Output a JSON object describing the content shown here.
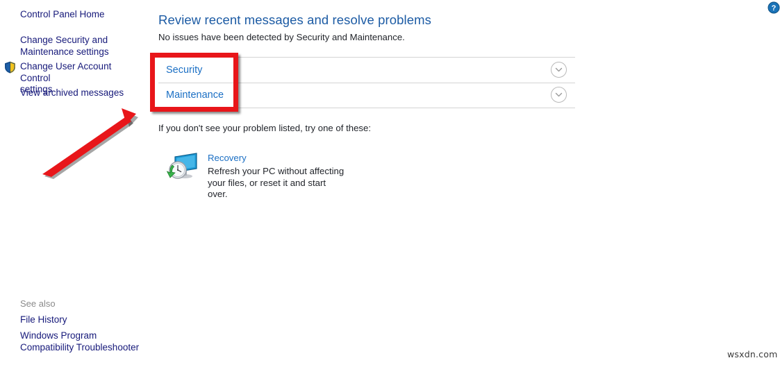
{
  "sidebar": {
    "items": [
      {
        "id": "control-panel-home",
        "label": "Control Panel Home"
      },
      {
        "id": "change-security-maintenance",
        "label": "Change Security and\nMaintenance settings"
      },
      {
        "id": "change-uac",
        "label": "Change User Account Control\nsettings",
        "icon": "uac-shield-icon"
      },
      {
        "id": "view-archived-messages",
        "label": "View archived messages"
      }
    ],
    "see_also": {
      "label": "See also",
      "items": [
        {
          "id": "file-history",
          "label": "File History"
        },
        {
          "id": "windows-program-compatibility-troubleshooter",
          "label": "Windows Program\nCompatibility Troubleshooter"
        }
      ]
    }
  },
  "main": {
    "title": "Review recent messages and resolve problems",
    "subtitle": "No issues have been detected by Security and Maintenance.",
    "expanders": [
      {
        "id": "security",
        "label": "Security",
        "chevron": "chevron-down-icon",
        "expanded": false
      },
      {
        "id": "maintenance",
        "label": "Maintenance",
        "chevron": "chevron-down-icon",
        "expanded": false
      }
    ],
    "hint": "If you don't see your problem listed, try one of these:",
    "recovery": {
      "icon": "recovery-icon",
      "link": "Recovery",
      "description": "Refresh your PC without affecting\nyour files, or reset it and start over."
    }
  },
  "help": {
    "icon": "help-question-icon"
  },
  "annotations": {
    "highlight_box": {
      "color": "#e8161a"
    },
    "arrow": {
      "color": "#e8161a"
    }
  },
  "watermark": {
    "text": "wsxdn.com"
  },
  "colors": {
    "link_blue": "#1b6fc4",
    "sidebar_link": "#16197a",
    "title_blue": "#1c5ba4",
    "body_text": "#22252b",
    "separator": "#d4d4d4",
    "annotation_red": "#e8161a",
    "help_blue": "#1a73b8"
  }
}
